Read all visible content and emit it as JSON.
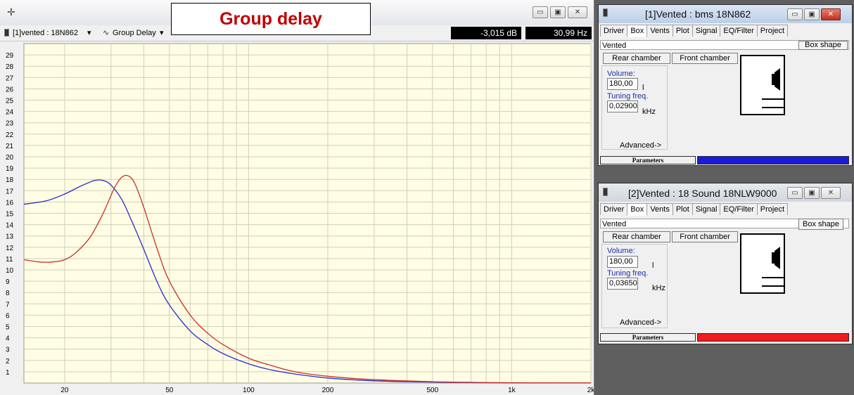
{
  "plot_window": {
    "toolbar_icon": "crosshair-icon",
    "driver_selector": "[1]vented : 18N862",
    "view_selector": "Group Delay",
    "level_readout": "-3,015 dB",
    "freq_readout": "30,99 Hz",
    "title_overlay": "Group delay"
  },
  "chart_data": {
    "type": "line",
    "title": "Group delay",
    "xlabel": "",
    "ylabel": "",
    "x_scale": "log",
    "xlim": [
      14,
      2000
    ],
    "ylim": [
      0,
      30
    ],
    "x_ticks": [
      20,
      50,
      100,
      200,
      500,
      1000,
      2000
    ],
    "x_tick_labels": [
      "20",
      "50",
      "100",
      "200",
      "500",
      "1k",
      "2k"
    ],
    "y_ticks": [
      1,
      2,
      3,
      4,
      5,
      6,
      7,
      8,
      9,
      10,
      11,
      12,
      13,
      14,
      15,
      16,
      17,
      18,
      19,
      20,
      21,
      22,
      23,
      24,
      25,
      26,
      27,
      28,
      29
    ],
    "grid": true,
    "background": "#fffde3",
    "series": [
      {
        "color": "#2b2bd0",
        "x": [
          14,
          17,
          20,
          23,
          26,
          28,
          30,
          33,
          36,
          40,
          45,
          50,
          60,
          70,
          80,
          100,
          120,
          150,
          200,
          300,
          500,
          700,
          1000,
          2000
        ],
        "y": [
          15.8,
          16.1,
          16.7,
          17.4,
          17.9,
          17.9,
          17.5,
          16.2,
          14.3,
          11.8,
          8.9,
          6.9,
          4.6,
          3.4,
          2.6,
          1.7,
          1.2,
          0.8,
          0.45,
          0.2,
          0.08,
          0.04,
          0.02,
          0.01
        ]
      },
      {
        "color": "#c8302a",
        "x": [
          14,
          16,
          18,
          20,
          22,
          25,
          28,
          31,
          33,
          35,
          37,
          40,
          45,
          50,
          60,
          70,
          80,
          100,
          120,
          150,
          200,
          300,
          500,
          700,
          1000,
          2000
        ],
        "y": [
          10.9,
          10.7,
          10.7,
          10.9,
          11.5,
          12.9,
          15.0,
          17.3,
          18.2,
          18.3,
          17.6,
          15.5,
          11.8,
          9.0,
          6.0,
          4.4,
          3.4,
          2.2,
          1.6,
          1.0,
          0.6,
          0.3,
          0.12,
          0.06,
          0.03,
          0.01
        ]
      }
    ]
  },
  "panel1": {
    "title": "[1]Vented : bms 18N862",
    "tabs": [
      "Driver",
      "Box",
      "Vents",
      "Plot",
      "Signal",
      "EQ/Filter",
      "Project"
    ],
    "box_type": "Vented",
    "box_shape_btn": "Box shape",
    "rear_btn": "Rear chamber",
    "front_btn": "Front chamber",
    "volume_label": "Volume:",
    "volume_value": "180,00",
    "volume_unit": "l",
    "tuning_label": "Tuning freq.",
    "tuning_value": "0,02900",
    "tuning_unit": "kHz",
    "advanced": "Advanced->",
    "params_label": "Parameters",
    "color": "#1a1adc"
  },
  "panel2": {
    "title": "[2]Vented : 18 Sound 18NLW9000",
    "tabs": [
      "Driver",
      "Box",
      "Vents",
      "Plot",
      "Signal",
      "EQ/Filter",
      "Project"
    ],
    "box_type": "Vented",
    "box_shape_btn": "Box shape",
    "rear_btn": "Rear chamber",
    "front_btn": "Front chamber",
    "volume_label": "Volume:",
    "volume_value": "180,00",
    "volume_unit": "l",
    "tuning_label": "Tuning freq.",
    "tuning_value": "0,03650",
    "tuning_unit": "kHz",
    "advanced": "Advanced->",
    "params_label": "Parameters",
    "color": "#ee1c1c"
  }
}
